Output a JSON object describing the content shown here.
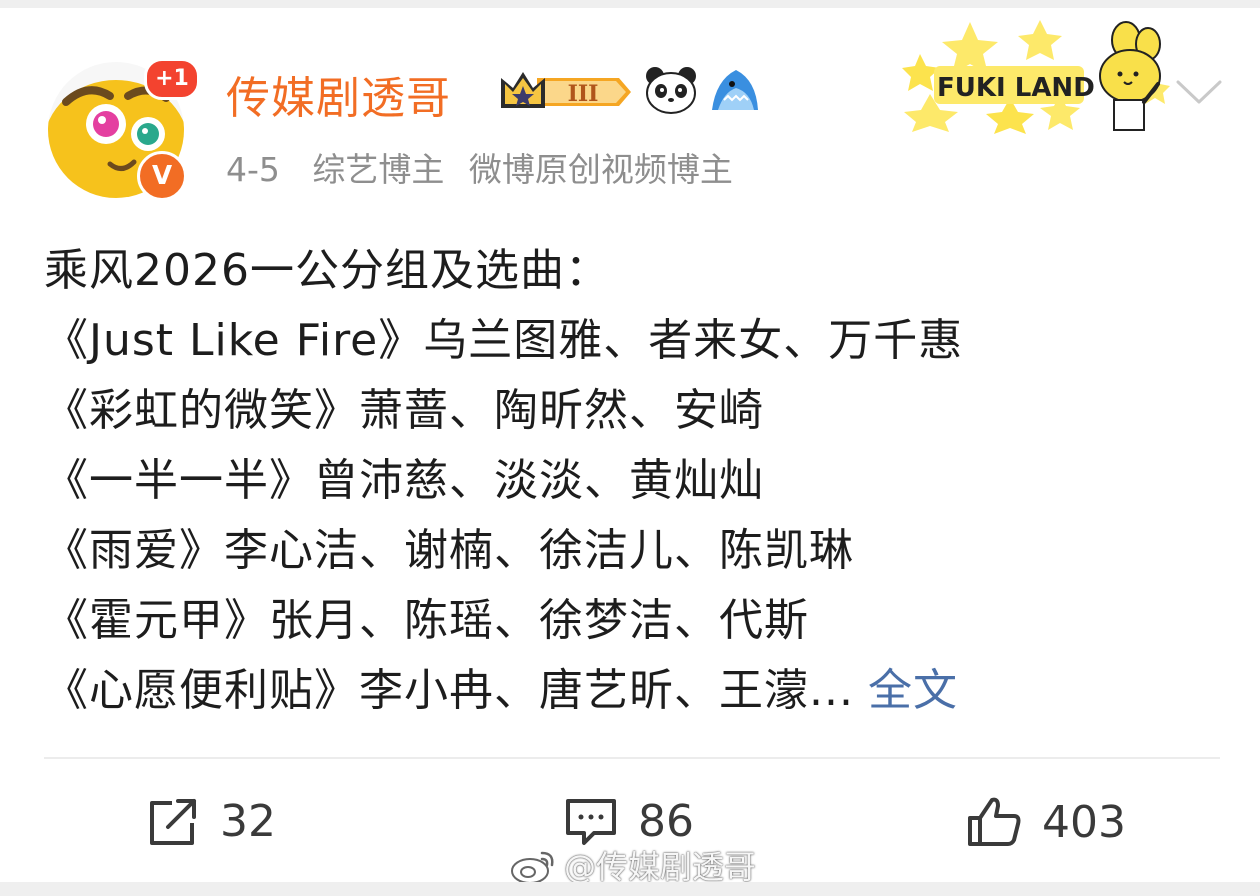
{
  "post": {
    "author": {
      "name": "传媒剧透哥",
      "avatar_badge": "+1",
      "verified_mark": "V",
      "level_badge": "III",
      "name_color": "#f26d24"
    },
    "date": "4-5",
    "tags": [
      "综艺博主",
      "微博原创视频博主"
    ],
    "decoration": "FUKI LAND",
    "content": {
      "lines": [
        "乘风2026一公分组及选曲：",
        "《Just Like Fire》乌兰图雅、者来女、万千惠",
        "《彩虹的微笑》萧蔷、陶昕然、安崎",
        "《一半一半》曾沛慈、淡淡、黄灿灿",
        "《雨爱》李心洁、谢楠、徐洁儿、陈凯琳",
        "《霍元甲》张月、陈瑶、徐梦洁、代斯",
        "《心愿便利贴》李小冉、唐艺昕、王濛..."
      ],
      "expand_label": "全文",
      "link_color": "#4a6fa8"
    },
    "actions": {
      "repost_count": "32",
      "comment_count": "86",
      "like_count": "403"
    },
    "watermark": "@传媒剧透哥"
  }
}
